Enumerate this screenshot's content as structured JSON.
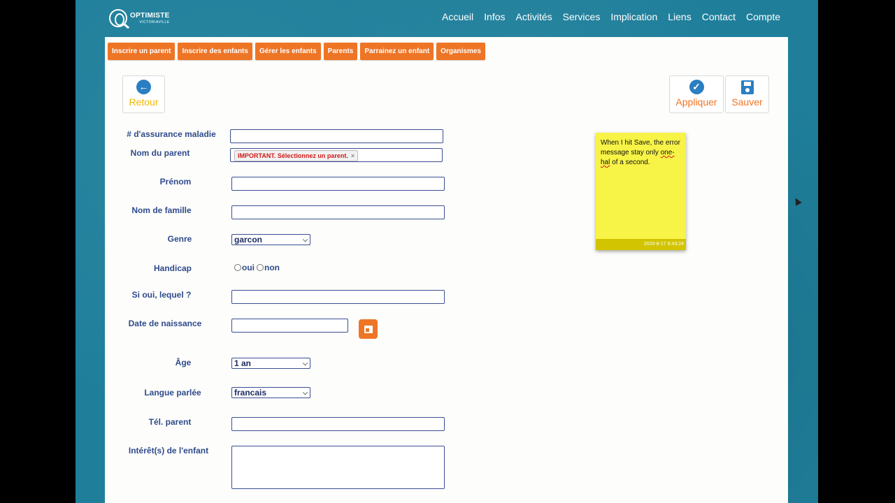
{
  "brand": {
    "name": "OPTIMISTE",
    "sub": "VICTORIAVILLE",
    "logo_icon": "optimist-logo-icon"
  },
  "topnav": [
    "Accueil",
    "Infos",
    "Activités",
    "Services",
    "Implication",
    "Liens",
    "Contact",
    "Compte"
  ],
  "subnav": [
    "Inscrire un parent",
    "Inscrire des enfants",
    "Gérer les enfants",
    "Parents",
    "Parrainez un enfant",
    "Organismes"
  ],
  "actions": {
    "back": "Retour",
    "apply": "Appliquer",
    "save": "Sauver"
  },
  "form": {
    "health_insurance_label": "# d'assurance maladie",
    "parent_name_label": "Nom du parent",
    "parent_chip": "IMPORTANT. Sélectionnez un parent.",
    "chip_remove": "×",
    "first_name_label": "Prénom",
    "last_name_label": "Nom de famille",
    "gender_label": "Genre",
    "gender_value": "garcon",
    "handicap_label": "Handicap",
    "handicap_yes": "oui",
    "handicap_no": "non",
    "handicap_which_label": "Si oui, lequel ?",
    "birthdate_label": "Date de naissance",
    "age_label": "Âge",
    "age_value": "1 an",
    "language_label": "Langue parlée",
    "language_value": "francais",
    "parent_phone_label": "Tél. parent",
    "interests_label": "Intérêt(s) de l'enfant"
  },
  "note": {
    "text_before": "When I hit Save, the error message stay only ",
    "text_underlined": "one-hal",
    "text_after": " of a second.",
    "timestamp": "2020-8-17 6:43:24"
  },
  "colors": {
    "accent_orange": "#ee7526",
    "label_blue": "#2f4b8c",
    "icon_blue": "#2a7ec2",
    "background_teal": "#1f7f9b",
    "note_yellow": "#f7f347"
  }
}
